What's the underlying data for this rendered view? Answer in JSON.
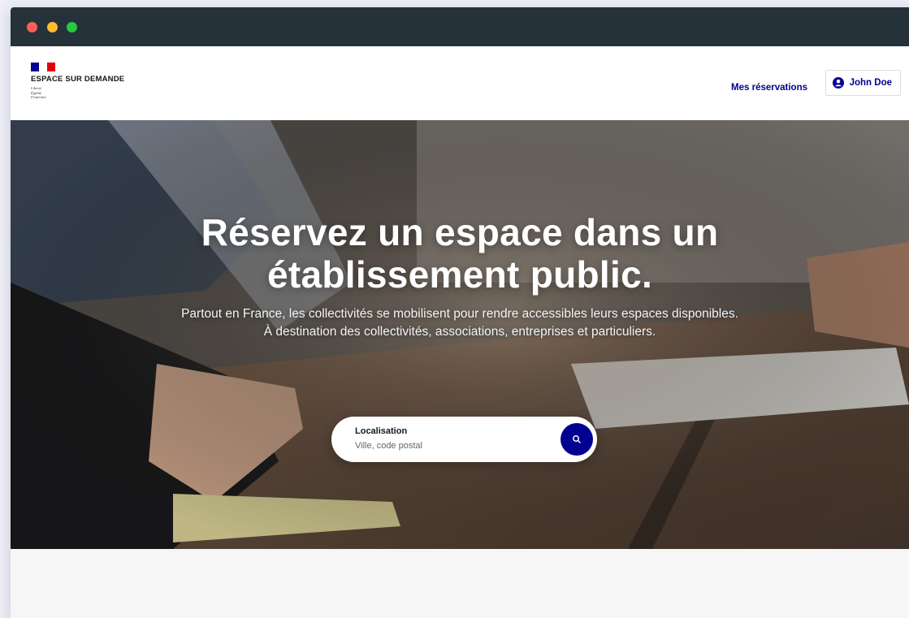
{
  "window": {
    "controls": [
      {
        "name": "close",
        "color": "#ff5f57"
      },
      {
        "name": "minimize",
        "color": "#febc2e"
      },
      {
        "name": "maximize",
        "color": "#28c840"
      }
    ],
    "titlebar_color": "#25323a"
  },
  "header": {
    "logo": {
      "title": "ESPACE SUR DEMANDE",
      "motto": [
        "Liberté",
        "Égalité",
        "Fraternité"
      ],
      "flag_colors": [
        "#000091",
        "#ffffff",
        "#e1000f"
      ]
    },
    "nav": {
      "reservations_label": "Mes réservations"
    },
    "user": {
      "name": "John Doe",
      "icon": "user-circle-icon"
    }
  },
  "hero": {
    "title_line1": "Réservez un espace dans un",
    "title_line2": "établissement public.",
    "description": "Partout en France, les collectivités se mobilisent pour rendre accessibles leurs espaces disponibles. À destination des collectivités, associations, entreprises et particuliers."
  },
  "search": {
    "label": "Localisation",
    "placeholder": "Ville, code postal",
    "button_icon": "search-icon"
  },
  "colors": {
    "accent": "#000091",
    "link": "#000091"
  }
}
